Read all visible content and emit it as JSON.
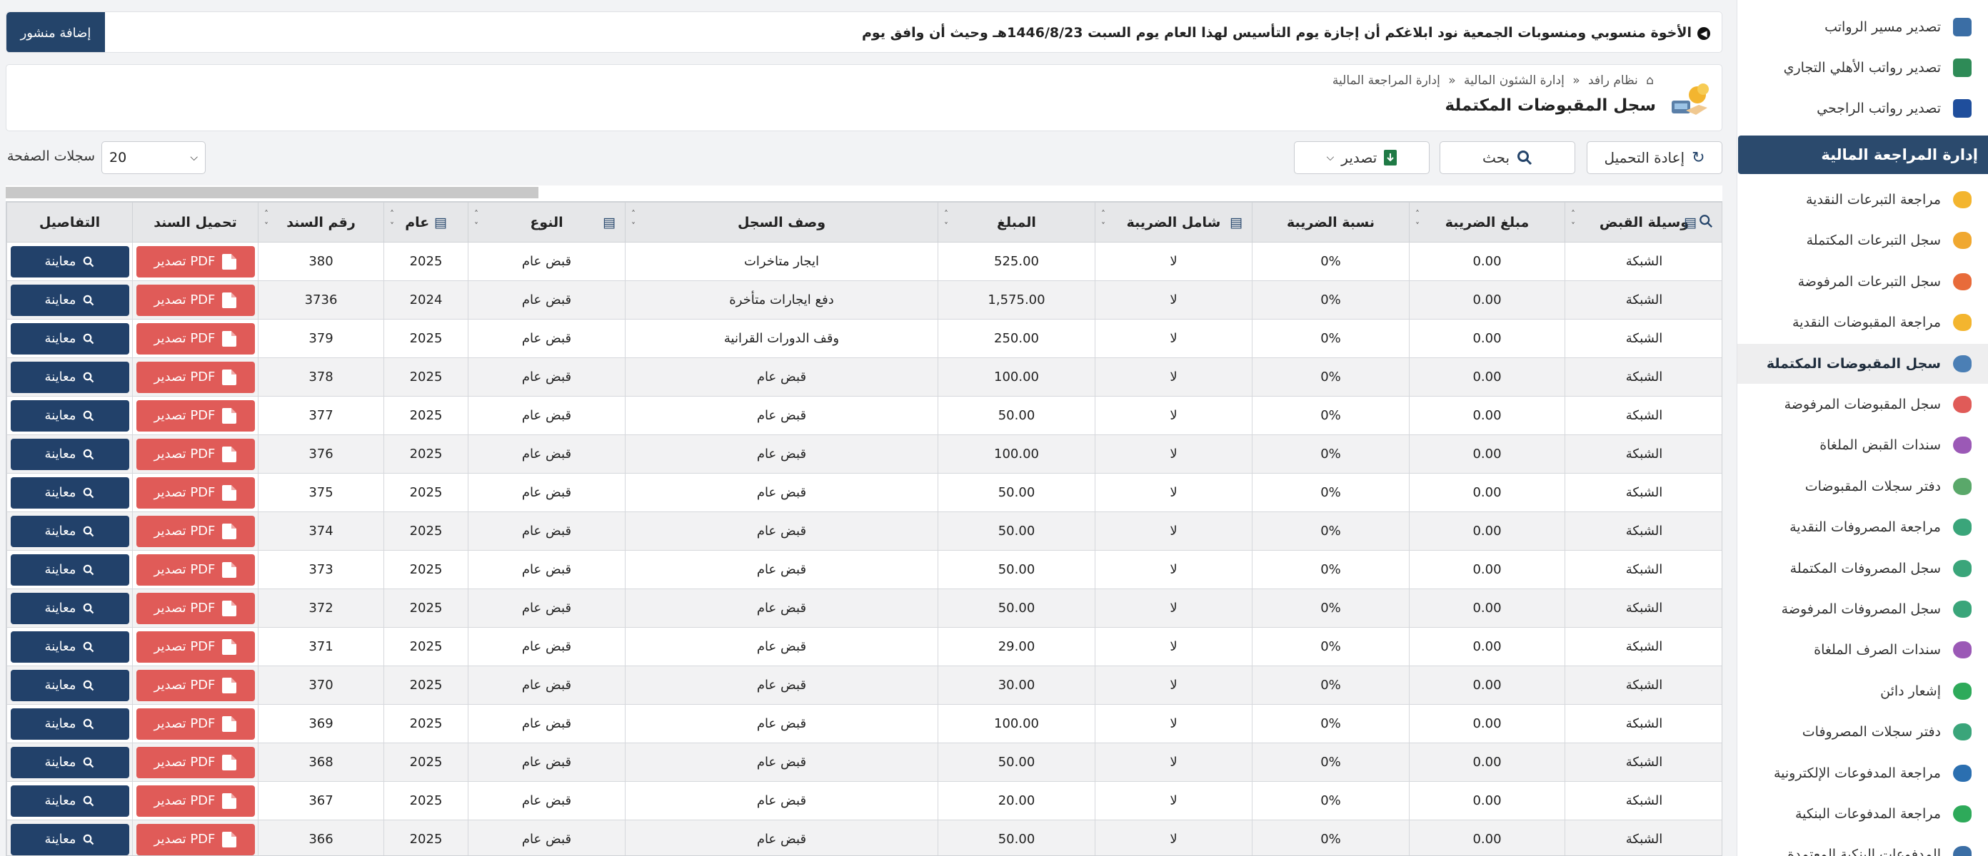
{
  "announcement": {
    "text": "الأخوة منسوبي ومنسوبات الجمعية نود ابلاغكم أن إجازة يوم التأسيس لهذا العام يوم السبت 1446/8/23هـ وحيث أن وافق يوم",
    "add_post_label": "إضافة منشور"
  },
  "page": {
    "breadcrumb": [
      "نظام رافد",
      "إدارة الشئون المالية",
      "إدارة المراجعة المالية"
    ],
    "title": "سجل المقبوضات المكتملة"
  },
  "toolbar": {
    "reload_label": "إعادة التحميل",
    "search_label": "بحث",
    "export_label": "تصدير",
    "per_page_label": "سجلات الصفحة",
    "per_page_value": "20"
  },
  "sidebar": {
    "top_items": [
      {
        "label": "تصدير مسير الرواتب",
        "icon": "payroll-export-icon"
      },
      {
        "label": "تصدير رواتب الأهلي التجاري",
        "icon": "ncb-bank-icon"
      },
      {
        "label": "تصدير رواتب الراجحي",
        "icon": "rajhi-bank-icon"
      }
    ],
    "section_title": "إدارة المراجعة المالية",
    "items": [
      {
        "label": "مراجعة التبرعات النقدية",
        "icon": "donation-review-icon",
        "active": false
      },
      {
        "label": "سجل التبرعات المكتملة",
        "icon": "donation-complete-icon",
        "active": false
      },
      {
        "label": "سجل التبرعات المرفوضة",
        "icon": "donation-rejected-icon",
        "active": false
      },
      {
        "label": "مراجعة المقبوضات النقدية",
        "icon": "receipts-review-icon",
        "active": false
      },
      {
        "label": "سجل المقبوضات المكتملة",
        "icon": "receipts-complete-icon",
        "active": true
      },
      {
        "label": "سجل المقبوضات المرفوضة",
        "icon": "receipts-rejected-icon",
        "active": false
      },
      {
        "label": "سندات القبض الملغاة",
        "icon": "receipts-cancelled-icon",
        "active": false
      },
      {
        "label": "دفتر سجلات المقبوضات",
        "icon": "receipts-ledger-icon",
        "active": false
      },
      {
        "label": "مراجعة المصروفات النقدية",
        "icon": "expenses-review-icon",
        "active": false
      },
      {
        "label": "سجل المصروفات المكتملة",
        "icon": "expenses-complete-icon",
        "active": false
      },
      {
        "label": "سجل المصروفات المرفوضة",
        "icon": "expenses-rejected-icon",
        "active": false
      },
      {
        "label": "سندات الصرف الملغاة",
        "icon": "expenses-cancelled-icon",
        "active": false
      },
      {
        "label": "إشعار دائن",
        "icon": "credit-note-icon",
        "active": false
      },
      {
        "label": "دفتر سجلات المصروفات",
        "icon": "expenses-ledger-icon",
        "active": false
      },
      {
        "label": "مراجعة المدفوعات الإلكترونية",
        "icon": "epayments-review-icon",
        "active": false
      },
      {
        "label": "مراجعة المدفوعات البنكية",
        "icon": "bank-payments-review-icon",
        "active": false
      },
      {
        "label": "المدفوعات البنكية المعتمدة",
        "icon": "bank-payments-approved-icon",
        "active": false
      }
    ]
  },
  "table": {
    "headers": {
      "method": "وسيلة القبض",
      "tax_amount": "مبلغ الضريبة",
      "tax_rate": "نسبة الضريبة",
      "tax_inclusive": "شامل الضريبة",
      "amount": "المبلغ",
      "description": "وصف السجل",
      "type": "النوع",
      "year": "عام",
      "voucher_no": "رقم السند",
      "download": "تحميل السند",
      "details": "التفاصيل"
    },
    "pdf_label": "تصدير PDF",
    "view_label": "معاينة",
    "rows": [
      {
        "method": "الشبكة",
        "tax_amount": "0.00",
        "tax_rate": "0%",
        "tax_inclusive": "لا",
        "amount": "525.00",
        "description": "ايجار متاخرات",
        "type": "قبض عام",
        "year": "2025",
        "voucher_no": "380"
      },
      {
        "method": "الشبكة",
        "tax_amount": "0.00",
        "tax_rate": "0%",
        "tax_inclusive": "لا",
        "amount": "1,575.00",
        "description": "دفع ايجارات متأخرة",
        "type": "قبض عام",
        "year": "2024",
        "voucher_no": "3736"
      },
      {
        "method": "الشبكة",
        "tax_amount": "0.00",
        "tax_rate": "0%",
        "tax_inclusive": "لا",
        "amount": "250.00",
        "description": "وقف الدورات القرانية",
        "type": "قبض عام",
        "year": "2025",
        "voucher_no": "379"
      },
      {
        "method": "الشبكة",
        "tax_amount": "0.00",
        "tax_rate": "0%",
        "tax_inclusive": "لا",
        "amount": "100.00",
        "description": "قبض عام",
        "type": "قبض عام",
        "year": "2025",
        "voucher_no": "378"
      },
      {
        "method": "الشبكة",
        "tax_amount": "0.00",
        "tax_rate": "0%",
        "tax_inclusive": "لا",
        "amount": "50.00",
        "description": "قبض عام",
        "type": "قبض عام",
        "year": "2025",
        "voucher_no": "377"
      },
      {
        "method": "الشبكة",
        "tax_amount": "0.00",
        "tax_rate": "0%",
        "tax_inclusive": "لا",
        "amount": "100.00",
        "description": "قبض عام",
        "type": "قبض عام",
        "year": "2025",
        "voucher_no": "376"
      },
      {
        "method": "الشبكة",
        "tax_amount": "0.00",
        "tax_rate": "0%",
        "tax_inclusive": "لا",
        "amount": "50.00",
        "description": "قبض عام",
        "type": "قبض عام",
        "year": "2025",
        "voucher_no": "375"
      },
      {
        "method": "الشبكة",
        "tax_amount": "0.00",
        "tax_rate": "0%",
        "tax_inclusive": "لا",
        "amount": "50.00",
        "description": "قبض عام",
        "type": "قبض عام",
        "year": "2025",
        "voucher_no": "374"
      },
      {
        "method": "الشبكة",
        "tax_amount": "0.00",
        "tax_rate": "0%",
        "tax_inclusive": "لا",
        "amount": "50.00",
        "description": "قبض عام",
        "type": "قبض عام",
        "year": "2025",
        "voucher_no": "373"
      },
      {
        "method": "الشبكة",
        "tax_amount": "0.00",
        "tax_rate": "0%",
        "tax_inclusive": "لا",
        "amount": "50.00",
        "description": "قبض عام",
        "type": "قبض عام",
        "year": "2025",
        "voucher_no": "372"
      },
      {
        "method": "الشبكة",
        "tax_amount": "0.00",
        "tax_rate": "0%",
        "tax_inclusive": "لا",
        "amount": "29.00",
        "description": "قبض عام",
        "type": "قبض عام",
        "year": "2025",
        "voucher_no": "371"
      },
      {
        "method": "الشبكة",
        "tax_amount": "0.00",
        "tax_rate": "0%",
        "tax_inclusive": "لا",
        "amount": "30.00",
        "description": "قبض عام",
        "type": "قبض عام",
        "year": "2025",
        "voucher_no": "370"
      },
      {
        "method": "الشبكة",
        "tax_amount": "0.00",
        "tax_rate": "0%",
        "tax_inclusive": "لا",
        "amount": "100.00",
        "description": "قبض عام",
        "type": "قبض عام",
        "year": "2025",
        "voucher_no": "369"
      },
      {
        "method": "الشبكة",
        "tax_amount": "0.00",
        "tax_rate": "0%",
        "tax_inclusive": "لا",
        "amount": "50.00",
        "description": "قبض عام",
        "type": "قبض عام",
        "year": "2025",
        "voucher_no": "368"
      },
      {
        "method": "الشبكة",
        "tax_amount": "0.00",
        "tax_rate": "0%",
        "tax_inclusive": "لا",
        "amount": "20.00",
        "description": "قبض عام",
        "type": "قبض عام",
        "year": "2025",
        "voucher_no": "367"
      },
      {
        "method": "الشبكة",
        "tax_amount": "0.00",
        "tax_rate": "0%",
        "tax_inclusive": "لا",
        "amount": "50.00",
        "description": "قبض عام",
        "type": "قبض عام",
        "year": "2025",
        "voucher_no": "366"
      }
    ]
  },
  "colors": {
    "primary": "#24446a",
    "pdf": "#e05b58",
    "sidebar_header": "#2b4a6d"
  }
}
